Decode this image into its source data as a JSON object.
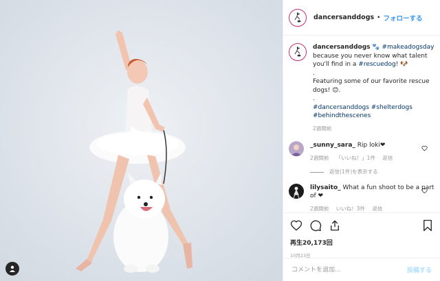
{
  "post": {
    "username": "dancersanddogs",
    "separator": "•",
    "follow_label": "フォローする"
  },
  "caption": {
    "username": "dancersanddogs",
    "emoji1": "🐾",
    "hashtag1": "#makeadogsday",
    "line1": "because you never know what talent you'll find in a",
    "hashtag2": "#rescuedog",
    "line1_end": "! 🐶",
    "dot1": ".",
    "line2": "Featuring some of our favorite rescue dogs! 😊.",
    "dot2": ".",
    "hashtags": "#dancersanddogs #shelterdogs #behindthescenes",
    "time": "2週間前"
  },
  "comments": [
    {
      "username": "_sunny_sara_",
      "text": "Rip loki❤",
      "time": "2週間前",
      "likes": "「いいね！」1件",
      "reply": "返信",
      "view_replies": "返信(1件)を表示する"
    },
    {
      "username": "lilysaito_",
      "text": "What a fun shoot to be a part of ❤",
      "time": "2週間前",
      "likes": "いいね！3件",
      "reply": "返信"
    }
  ],
  "stats": {
    "views": "再生20,173回",
    "date": "10月23日"
  },
  "composer": {
    "placeholder": "コメントを追加...",
    "post_label": "投稿する"
  },
  "colors": {
    "link": "#3897f0",
    "hashtag": "#003569",
    "muted": "#999999",
    "background_media": "#dfe4ea"
  },
  "icons": [
    "play-icon",
    "user-tag-icon",
    "heart-icon",
    "comment-icon",
    "share-icon",
    "bookmark-icon"
  ]
}
